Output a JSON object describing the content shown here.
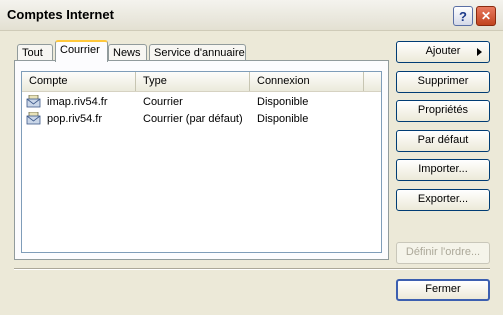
{
  "window": {
    "title": "Comptes Internet",
    "help_glyph": "?",
    "close_glyph": "✕"
  },
  "tabs": [
    {
      "label": "Tout"
    },
    {
      "label": "Courrier"
    },
    {
      "label": "News"
    },
    {
      "label": "Service d'annuaire"
    }
  ],
  "active_tab": "Courrier",
  "columns": [
    "Compte",
    "Type",
    "Connexion"
  ],
  "accounts": [
    {
      "name": "imap.riv54.fr",
      "type": "Courrier",
      "connection": "Disponible"
    },
    {
      "name": "pop.riv54.fr",
      "type": "Courrier (par défaut)",
      "connection": "Disponible"
    }
  ],
  "buttons": {
    "add": "Ajouter",
    "remove": "Supprimer",
    "properties": "Propriétés",
    "set_default": "Par défaut",
    "import": "Importer...",
    "export": "Exporter...",
    "set_order": "Définir l'ordre...",
    "close": "Fermer"
  },
  "icons": {
    "account": "mail-account-icon",
    "help": "help-icon",
    "close": "close-icon",
    "add_arrow": "arrow-right-icon"
  }
}
